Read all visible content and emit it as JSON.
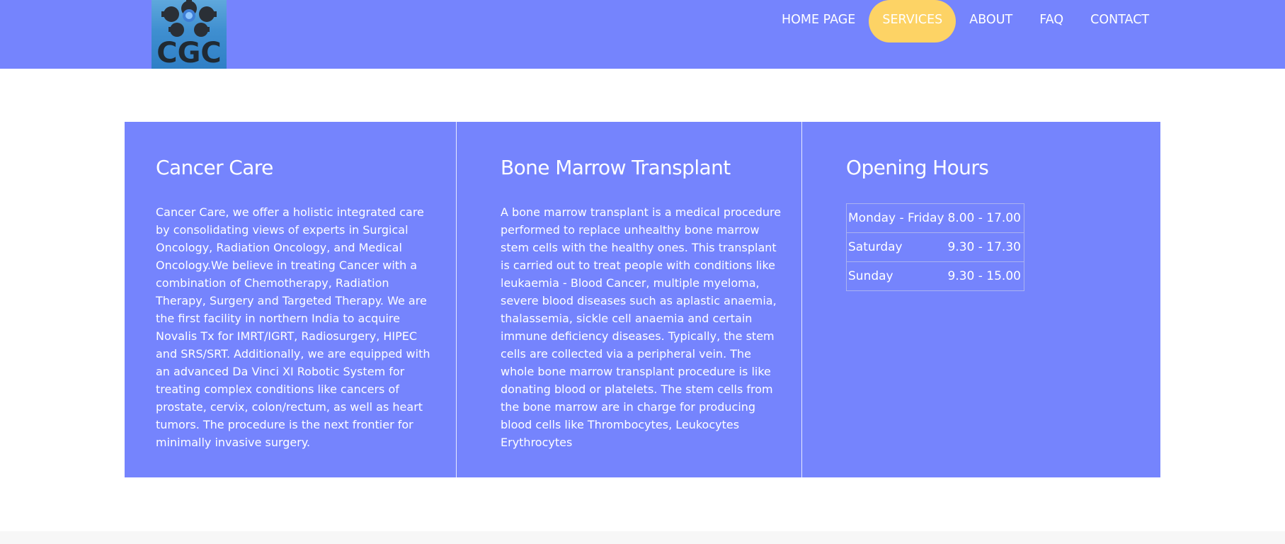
{
  "header": {
    "logo_text": "CGC",
    "nav": [
      {
        "label": "HOME PAGE"
      },
      {
        "label": "SERVICES"
      },
      {
        "label": "ABOUT"
      },
      {
        "label": "FAQ"
      },
      {
        "label": "CONTACT"
      }
    ],
    "active_nav": "SERVICES"
  },
  "panels": {
    "cancer_care": {
      "title": "Cancer Care",
      "text": "Cancer Care, we offer a holistic integrated care by consolidating views of experts in Surgical Oncology, Radiation Oncology, and Medical Oncology.We believe in treating Cancer with a combination of Chemotherapy, Radiation Therapy, Surgery and Targeted Therapy. We are the first facility in northern India to acquire Novalis Tx for IMRT/IGRT, Radiosurgery, HIPEC and SRS/SRT. Additionally, we are equipped with an advanced Da Vinci XI Robotic System for treating complex conditions like cancers of prostate, cervix, colon/rectum, as well as heart tumors. The procedure is the next frontier for minimally invasive surgery."
    },
    "bone_marrow": {
      "title": "Bone Marrow Transplant",
      "text": "A bone marrow transplant is a medical procedure performed to replace unhealthy bone marrow stem cells with the healthy ones. This transplant is carried out to treat people with conditions like leukaemia - Blood Cancer, multiple myeloma, severe blood diseases such as aplastic anaemia, thalassemia, sickle cell anaemia and certain immune deficiency diseases. Typically, the stem cells are collected via a peripheral vein. The whole bone marrow transplant procedure is like donating blood or platelets. The stem cells from the bone marrow are in charge for producing blood cells like Thrombocytes, Leukocytes Erythrocytes"
    },
    "opening_hours": {
      "title": "Opening Hours",
      "rows": [
        {
          "day": "Monday - Friday",
          "time": "8.00 - 17.00"
        },
        {
          "day": "Saturday",
          "time": "9.30 - 17.30"
        },
        {
          "day": "Sunday",
          "time": "9.30 - 15.00"
        }
      ]
    }
  },
  "colors": {
    "primary": "#7584fd",
    "accent": "#fdd365",
    "text": "#ffffff"
  }
}
